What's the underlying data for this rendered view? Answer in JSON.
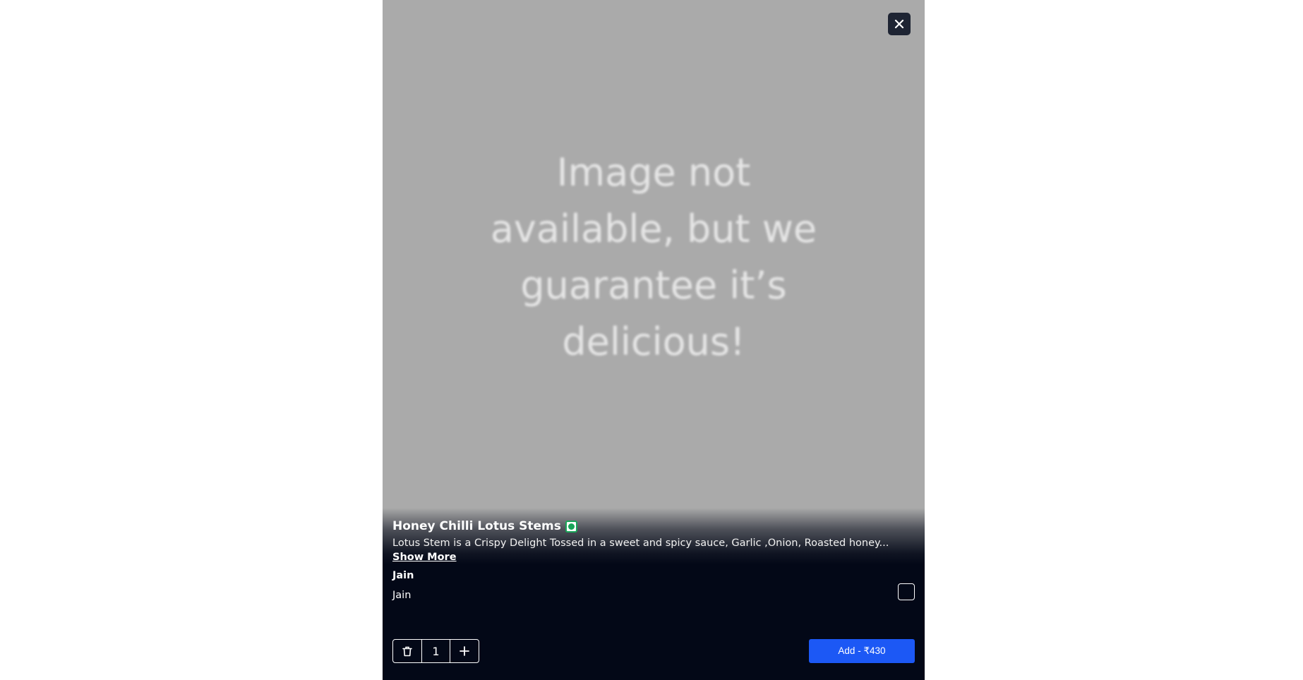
{
  "modal": {
    "placeholder_text": "Image not available, but we guarantee it’s delicious!",
    "close_icon": "close-icon"
  },
  "item": {
    "name": "Honey Chilli Lotus Stems",
    "diet_icon": "veg-indicator-icon",
    "description": "Lotus Stem is a Crispy Delight Tossed in a sweet and spicy sauce, Garlic ,Onion, Roasted honey...",
    "show_more_label": "Show More"
  },
  "options": {
    "group_title": "Jain",
    "items": [
      {
        "label": "Jain",
        "checked": false
      }
    ]
  },
  "cart": {
    "quantity": "1",
    "delete_icon": "trash-icon",
    "increment_icon": "plus-icon",
    "add_button_label": "Add - ₹430"
  },
  "colors": {
    "image_bg": "#aaaaaa",
    "panel_bg": "#030817",
    "accent": "#1c58f5",
    "veg_green": "#18a558"
  }
}
